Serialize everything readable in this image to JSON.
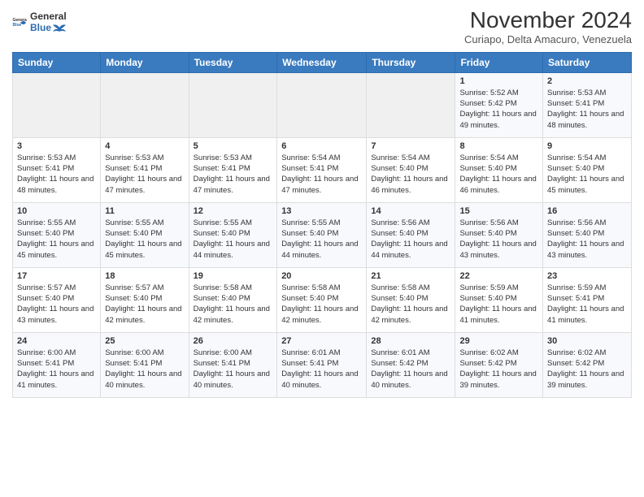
{
  "header": {
    "logo": {
      "general": "General",
      "blue": "Blue"
    },
    "title": "November 2024",
    "location": "Curiapo, Delta Amacuro, Venezuela"
  },
  "weekdays": [
    "Sunday",
    "Monday",
    "Tuesday",
    "Wednesday",
    "Thursday",
    "Friday",
    "Saturday"
  ],
  "weeks": [
    [
      null,
      null,
      null,
      null,
      null,
      {
        "day": 1,
        "sunrise": "5:52 AM",
        "sunset": "5:42 PM",
        "daylight": "11 hours and 49 minutes."
      },
      {
        "day": 2,
        "sunrise": "5:53 AM",
        "sunset": "5:41 PM",
        "daylight": "11 hours and 48 minutes."
      }
    ],
    [
      {
        "day": 3,
        "sunrise": "5:53 AM",
        "sunset": "5:41 PM",
        "daylight": "11 hours and 48 minutes."
      },
      {
        "day": 4,
        "sunrise": "5:53 AM",
        "sunset": "5:41 PM",
        "daylight": "11 hours and 47 minutes."
      },
      {
        "day": 5,
        "sunrise": "5:53 AM",
        "sunset": "5:41 PM",
        "daylight": "11 hours and 47 minutes."
      },
      {
        "day": 6,
        "sunrise": "5:54 AM",
        "sunset": "5:41 PM",
        "daylight": "11 hours and 47 minutes."
      },
      {
        "day": 7,
        "sunrise": "5:54 AM",
        "sunset": "5:40 PM",
        "daylight": "11 hours and 46 minutes."
      },
      {
        "day": 8,
        "sunrise": "5:54 AM",
        "sunset": "5:40 PM",
        "daylight": "11 hours and 46 minutes."
      },
      {
        "day": 9,
        "sunrise": "5:54 AM",
        "sunset": "5:40 PM",
        "daylight": "11 hours and 45 minutes."
      }
    ],
    [
      {
        "day": 10,
        "sunrise": "5:55 AM",
        "sunset": "5:40 PM",
        "daylight": "11 hours and 45 minutes."
      },
      {
        "day": 11,
        "sunrise": "5:55 AM",
        "sunset": "5:40 PM",
        "daylight": "11 hours and 45 minutes."
      },
      {
        "day": 12,
        "sunrise": "5:55 AM",
        "sunset": "5:40 PM",
        "daylight": "11 hours and 44 minutes."
      },
      {
        "day": 13,
        "sunrise": "5:55 AM",
        "sunset": "5:40 PM",
        "daylight": "11 hours and 44 minutes."
      },
      {
        "day": 14,
        "sunrise": "5:56 AM",
        "sunset": "5:40 PM",
        "daylight": "11 hours and 44 minutes."
      },
      {
        "day": 15,
        "sunrise": "5:56 AM",
        "sunset": "5:40 PM",
        "daylight": "11 hours and 43 minutes."
      },
      {
        "day": 16,
        "sunrise": "5:56 AM",
        "sunset": "5:40 PM",
        "daylight": "11 hours and 43 minutes."
      }
    ],
    [
      {
        "day": 17,
        "sunrise": "5:57 AM",
        "sunset": "5:40 PM",
        "daylight": "11 hours and 43 minutes."
      },
      {
        "day": 18,
        "sunrise": "5:57 AM",
        "sunset": "5:40 PM",
        "daylight": "11 hours and 42 minutes."
      },
      {
        "day": 19,
        "sunrise": "5:58 AM",
        "sunset": "5:40 PM",
        "daylight": "11 hours and 42 minutes."
      },
      {
        "day": 20,
        "sunrise": "5:58 AM",
        "sunset": "5:40 PM",
        "daylight": "11 hours and 42 minutes."
      },
      {
        "day": 21,
        "sunrise": "5:58 AM",
        "sunset": "5:40 PM",
        "daylight": "11 hours and 42 minutes."
      },
      {
        "day": 22,
        "sunrise": "5:59 AM",
        "sunset": "5:40 PM",
        "daylight": "11 hours and 41 minutes."
      },
      {
        "day": 23,
        "sunrise": "5:59 AM",
        "sunset": "5:41 PM",
        "daylight": "11 hours and 41 minutes."
      }
    ],
    [
      {
        "day": 24,
        "sunrise": "6:00 AM",
        "sunset": "5:41 PM",
        "daylight": "11 hours and 41 minutes."
      },
      {
        "day": 25,
        "sunrise": "6:00 AM",
        "sunset": "5:41 PM",
        "daylight": "11 hours and 40 minutes."
      },
      {
        "day": 26,
        "sunrise": "6:00 AM",
        "sunset": "5:41 PM",
        "daylight": "11 hours and 40 minutes."
      },
      {
        "day": 27,
        "sunrise": "6:01 AM",
        "sunset": "5:41 PM",
        "daylight": "11 hours and 40 minutes."
      },
      {
        "day": 28,
        "sunrise": "6:01 AM",
        "sunset": "5:42 PM",
        "daylight": "11 hours and 40 minutes."
      },
      {
        "day": 29,
        "sunrise": "6:02 AM",
        "sunset": "5:42 PM",
        "daylight": "11 hours and 39 minutes."
      },
      {
        "day": 30,
        "sunrise": "6:02 AM",
        "sunset": "5:42 PM",
        "daylight": "11 hours and 39 minutes."
      }
    ]
  ]
}
